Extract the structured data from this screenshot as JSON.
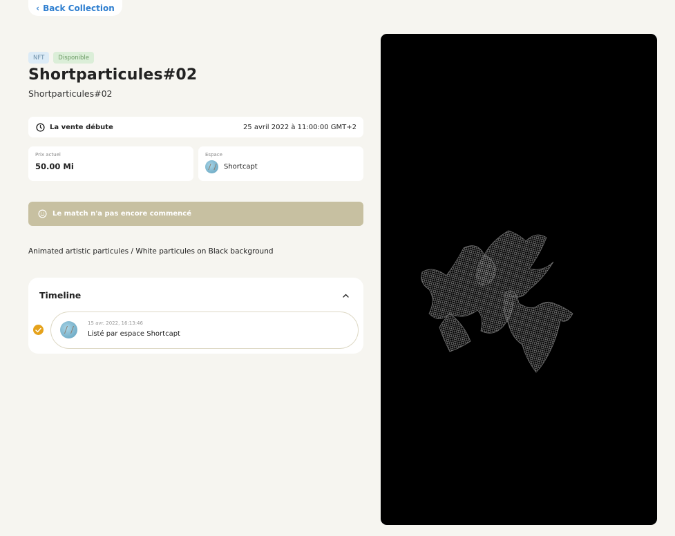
{
  "nav": {
    "back_label": "Back Collection"
  },
  "badges": {
    "nft": "NFT",
    "status": "Disponible"
  },
  "item": {
    "title": "Shortparticules#02",
    "subtitle": "Shortparticules#02",
    "description": "Animated artistic particules / White particules on Black background"
  },
  "sale": {
    "label": "La vente débute",
    "date": "25 avril 2022 à 11:00:00 GMT+2"
  },
  "price": {
    "caption": "Prix actuel",
    "value": "50.00 Mi"
  },
  "space": {
    "caption": "Espace",
    "name": "Shortcapt"
  },
  "match": {
    "text": "Le match n'a pas encore commencé"
  },
  "timeline": {
    "title": "Timeline",
    "events": [
      {
        "date": "15 avr. 2022, 16:13:46",
        "text": "Listé par espace Shortcapt"
      }
    ]
  },
  "icons": {
    "back": "chevron-left-icon",
    "clock": "clock-icon",
    "smiley": "smiley-icon",
    "collapse": "chevron-up-icon",
    "check": "check-icon"
  },
  "colors": {
    "accent": "#2f7fd0",
    "match_bar": "#c7c0a1",
    "check": "#e5a21b",
    "background": "#f6f5f0"
  }
}
